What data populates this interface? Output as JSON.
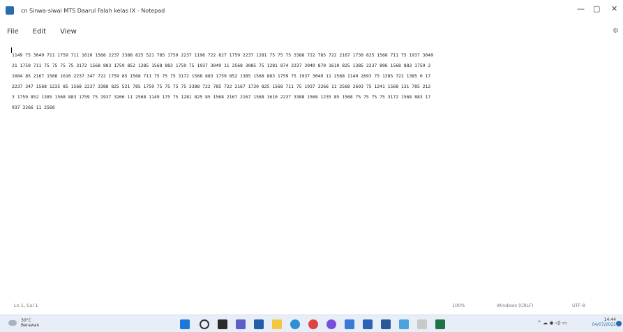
{
  "window": {
    "title": "cn Sinwa-siwai MTS Daarul Falah kelas IX - Notepad",
    "controls": {
      "minimize": "—",
      "maximize": "▢",
      "close": "✕"
    }
  },
  "menu": {
    "items": [
      "File",
      "Edit",
      "View"
    ],
    "settings_icon": "gear-icon"
  },
  "editor": {
    "lines": [
      "1149 75 3049 711 1759 711 1610 1568 2237 3388 825 521 785 1759 2237 1196 722 827 1759 2237 1281 75 75 75 3388 722 785 722 2167 1730 825 1568 711 75 1937 3049",
      "21 1759 711 75 75 75 75 3172 1568 883 1759 852 1385 1568 883 1759 75 1937 3049 11 2568 3085 75 1281 874 2237 3049 870 1610 825 1385 2237 896 1568 883 1759 2",
      "1684 85 2167 1568 1610 2237 347 722 1759 85 1568 711 75 75 75 3172 1568 883 1759 852 1385 1568 883 1759 75 1937 3049 11 2568 1149 2693 75 1385 722 1385 0 17",
      "2237 347 1568 1235 85 1568 2237 3388 825 521 785 1759 75 75 75 75 3388 722 785 722 2167 1730 825 1568 711 75 1937 3266 11 2568 2693 75 1241 1568 131 785 212",
      "3 1759 852 1385 1568 883 1759 75 1937 3266 11 2568 1149 175 75 1281 825 85 1568 2167 2167 1568 1610 2237 3388 1568 1235 85 1568 75 75 75 75 3172 1568 883 17",
      "937 3266 11 2568"
    ]
  },
  "status": {
    "position": "Ln 1, Col 1",
    "zoom": "100%",
    "line_ending": "Windows (CRLF)",
    "encoding": "UTF-8"
  },
  "taskbar": {
    "weather_temp": "30°C",
    "weather_desc": "Berawan",
    "apps": [
      "windows-start",
      "search",
      "task-view",
      "chat",
      "file-explorer",
      "store",
      "edge",
      "chrome",
      "canva",
      "photos",
      "security",
      "word",
      "notepad",
      "word-2",
      "excel"
    ],
    "tray_icons": "^ ☁ ◉ ◁) ▭",
    "time": "14:44",
    "date": "04/07/2022"
  }
}
